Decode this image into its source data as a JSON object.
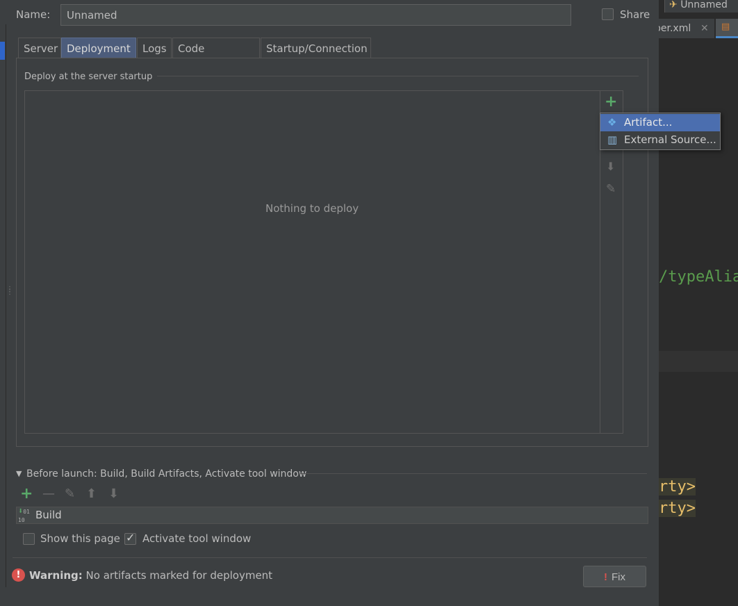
{
  "colors": {
    "accent_selection": "#4b6eaf",
    "tab_active": "#4c5c7b",
    "add_green": "#59a869",
    "warning_red": "#d9534f",
    "dialog_bg": "#3c3f41",
    "editor_bg": "#2b2b2b"
  },
  "background_editor": {
    "run_config_tab": "Unnamed",
    "file_tab": "per.xml",
    "code_fragment_1": "/typeAlia",
    "code_fragment_2": "rty>",
    "code_fragment_3": "rty>"
  },
  "dialog": {
    "name_label": "Name:",
    "name_value": "Unnamed",
    "share_label": "Share",
    "share_checked": false,
    "tabs": [
      {
        "label": "Server",
        "active": false
      },
      {
        "label": "Deployment",
        "active": true
      },
      {
        "label": "Logs",
        "active": false
      },
      {
        "label": "Code Coverage",
        "active": false
      },
      {
        "label": "Startup/Connection",
        "active": false
      }
    ],
    "deploy_section_title": "Deploy at the server startup",
    "empty_message": "Nothing to deploy",
    "toolbar_icons": [
      "add-icon",
      "move-down-icon",
      "edit-icon"
    ],
    "popup_menu": [
      {
        "label": "Artifact...",
        "icon": "artifact-icon",
        "selected": true
      },
      {
        "label": "External Source...",
        "icon": "archive-icon",
        "selected": false
      }
    ],
    "before_launch": {
      "title": "Before launch: Build, Build Artifacts, Activate tool window",
      "toolbar_icons": [
        "add-icon",
        "remove-icon",
        "edit-icon",
        "move-up-icon",
        "move-down-icon"
      ],
      "tasks": [
        {
          "label": "Build",
          "icon": "build-icon"
        }
      ]
    },
    "show_this_page_label": "Show this page",
    "show_this_page_checked": false,
    "activate_tool_window_label": "Activate tool window",
    "activate_tool_window_checked": true,
    "warning_label": "Warning:",
    "warning_message": "No artifacts marked for deployment",
    "fix_button_label": "Fix"
  }
}
